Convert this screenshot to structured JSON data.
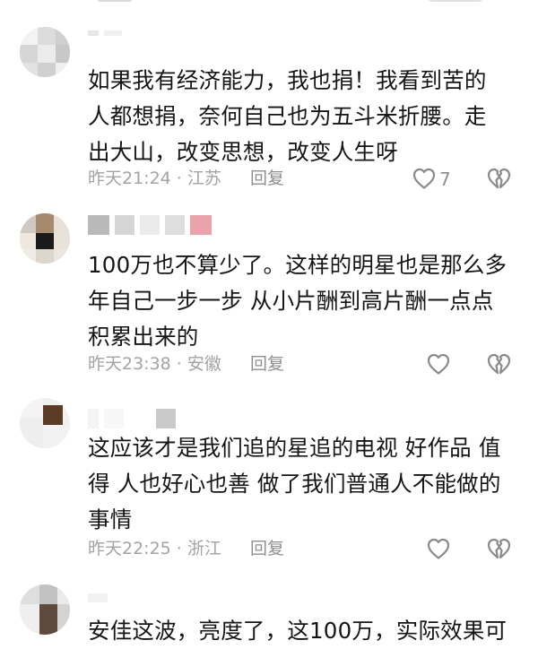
{
  "comments": [
    {
      "text_lines": [
        "如果我有经济能力，我也捐！我看到苦的",
        "人都想捐，奈何自己也为五斗米折腰。走",
        "出大山，改变思想，改变人生呀"
      ],
      "time": "昨天21:24",
      "location": "江苏",
      "reply_label": "回复",
      "like_count": "7"
    },
    {
      "text_lines": [
        "100万也不算少了。这样的明星也是那么多",
        "年自己一步一步 从小片酬到高片酬一点点",
        "积累出来的"
      ],
      "time": "昨天23:38",
      "location": "安徽",
      "reply_label": "回复",
      "like_count": ""
    },
    {
      "text_lines": [
        "这应该才是我们追的星追的电视 好作品 值",
        "得 人也好心也善 做了我们普通人不能做的",
        "事情"
      ],
      "time": "昨天22:25",
      "location": "浙江",
      "reply_label": "回复",
      "like_count": ""
    },
    {
      "text_lines": [
        "安佳这波，亮度了，这100万，实际效果可"
      ],
      "time": "",
      "location": "",
      "reply_label": "",
      "like_count": ""
    }
  ],
  "meta_separator": " · "
}
